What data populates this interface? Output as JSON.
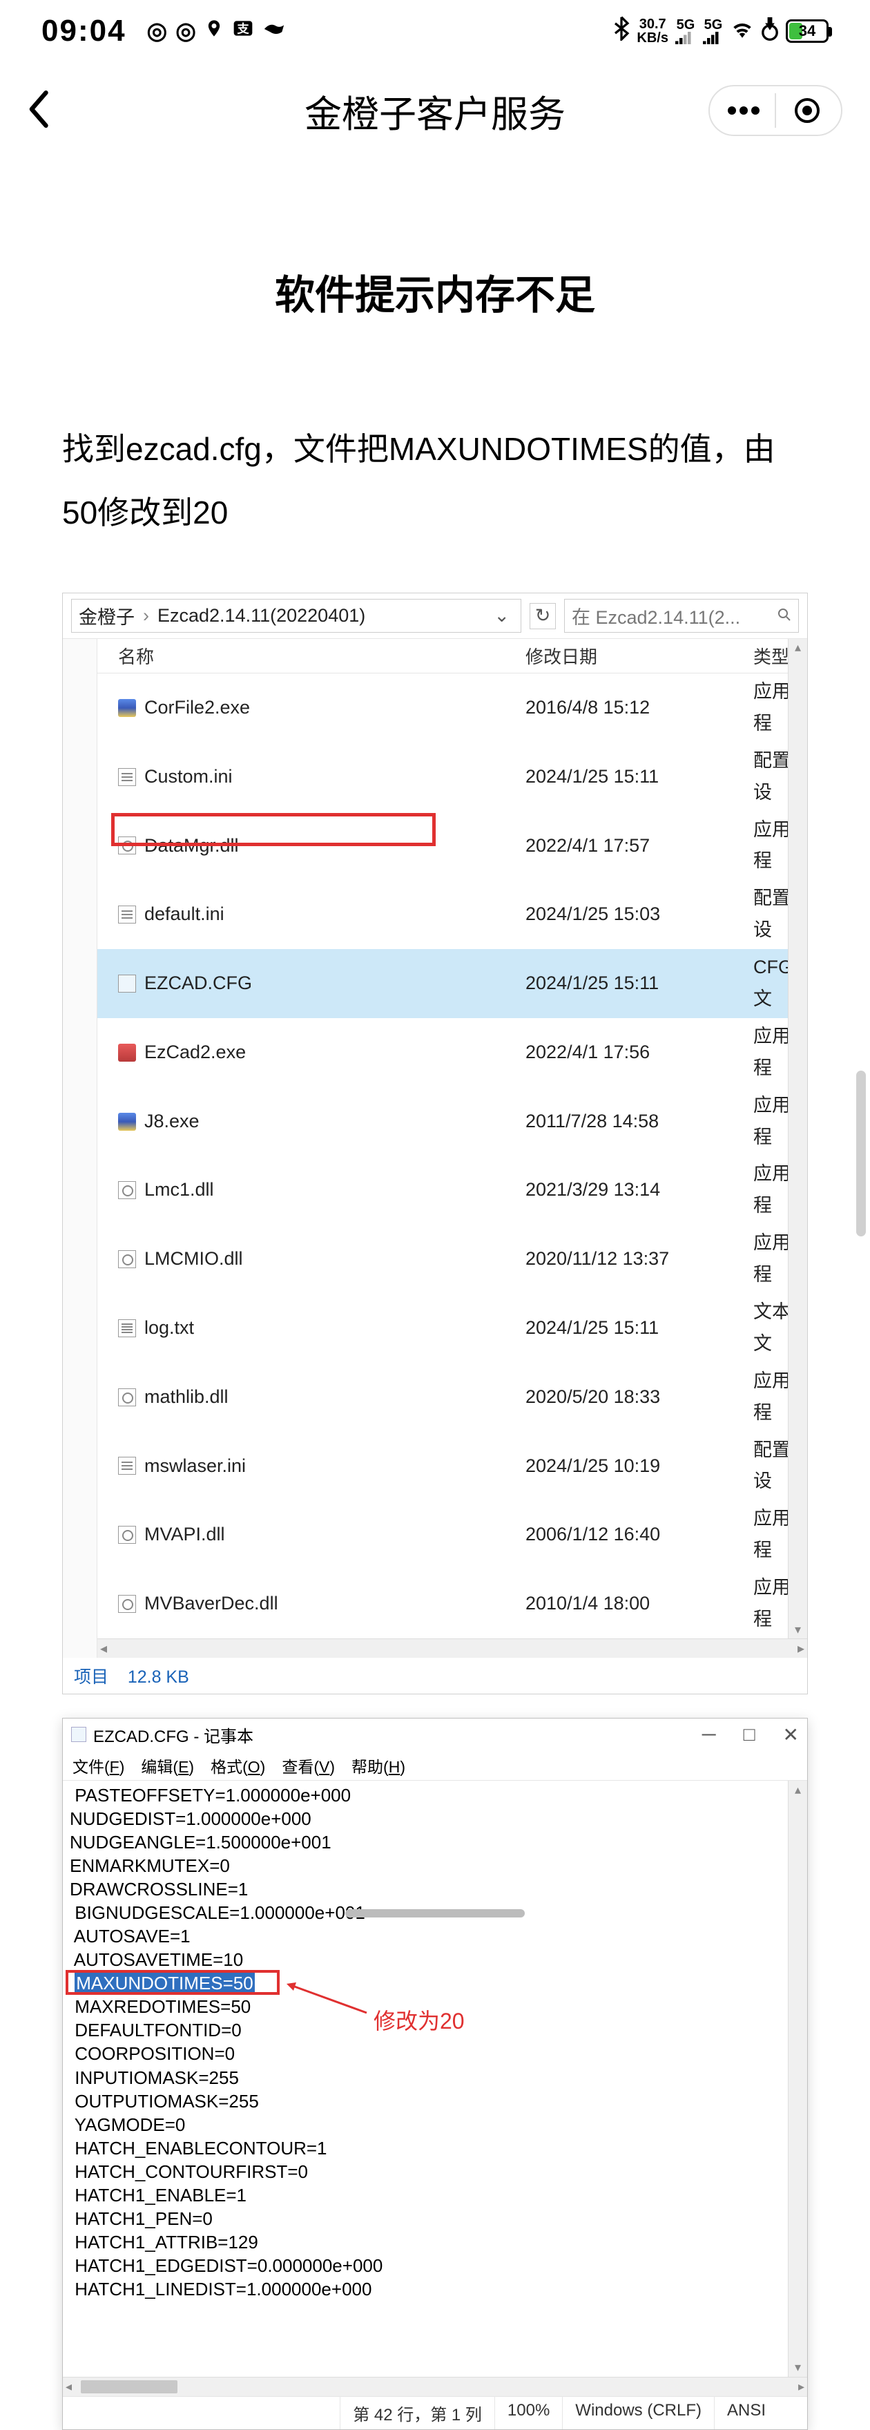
{
  "status": {
    "time": "09:04",
    "net_rate_top": "30.7",
    "net_rate_bot": "KB/s",
    "sig1": "5G",
    "sig2": "5G",
    "battery_pct": "34"
  },
  "header": {
    "title": "金橙子客户服务"
  },
  "article": {
    "title": "软件提示内存不足",
    "instruction": "找到ezcad.cfg，文件把MAXUNDOTIMES的值，由50修改到20"
  },
  "explorer": {
    "crumb1": "金橙子",
    "crumb2": "Ezcad2.14.11(20220401)",
    "search_placeholder": "在 Ezcad2.14.11(2...",
    "col_name": "名称",
    "col_date": "修改日期",
    "col_type": "类型",
    "files": [
      {
        "icon": "exe3",
        "name": "CorFile2.exe",
        "date": "2016/4/8 15:12",
        "type": "应用程"
      },
      {
        "icon": "ini",
        "name": "Custom.ini",
        "date": "2024/1/25 15:11",
        "type": "配置设"
      },
      {
        "icon": "dll",
        "name": "DataMgr.dll",
        "date": "2022/4/1 17:57",
        "type": "应用程"
      },
      {
        "icon": "ini",
        "name": "default.ini",
        "date": "2024/1/25 15:03",
        "type": "配置设"
      },
      {
        "icon": "cfg",
        "name": "EZCAD.CFG",
        "date": "2024/1/25 15:11",
        "type": "CFG 文",
        "sel": true
      },
      {
        "icon": "exe2",
        "name": "EzCad2.exe",
        "date": "2022/4/1 17:56",
        "type": "应用程"
      },
      {
        "icon": "exe3",
        "name": "J8.exe",
        "date": "2011/7/28 14:58",
        "type": "应用程"
      },
      {
        "icon": "dll",
        "name": "Lmc1.dll",
        "date": "2021/3/29 13:14",
        "type": "应用程"
      },
      {
        "icon": "dll",
        "name": "LMCMIO.dll",
        "date": "2020/11/12 13:37",
        "type": "应用程"
      },
      {
        "icon": "txt",
        "name": "log.txt",
        "date": "2024/1/25 15:11",
        "type": "文本文"
      },
      {
        "icon": "dll",
        "name": "mathlib.dll",
        "date": "2020/5/20 18:33",
        "type": "应用程"
      },
      {
        "icon": "ini",
        "name": "mswlaser.ini",
        "date": "2024/1/25 10:19",
        "type": "配置设"
      },
      {
        "icon": "dll",
        "name": "MVAPI.dll",
        "date": "2006/1/12 16:40",
        "type": "应用程"
      },
      {
        "icon": "dll",
        "name": "MVBaverDec.dll",
        "date": "2010/1/4 18:00",
        "type": "应用程"
      }
    ],
    "footer_label": "项目",
    "footer_size": "12.8 KB"
  },
  "notepad": {
    "title": "EZCAD.CFG - 记事本",
    "menu": {
      "file": "文件(F)",
      "edit": "编辑(E)",
      "format": "格式(O)",
      "view": "查看(V)",
      "help": "帮助(H)"
    },
    "lines_before": [
      " PASTEOFFSETY=1.000000e+000",
      "NUDGEDIST=1.000000e+000",
      "NUDGEANGLE=1.500000e+001",
      "ENMARKMUTEX=0",
      "DRAWCROSSLINE=1",
      " BIGNUDGESCALE=1.000000e+001",
      " AUTOSAVE=1",
      " AUTOSAVETIME=10"
    ],
    "highlight_line": "MAXUNDOTIMES=50",
    "lines_after": [
      " MAXREDOTIMES=50",
      " DEFAULTFONTID=0",
      " COORPOSITION=0",
      " INPUTIOMASK=255",
      " OUTPUTIOMASK=255",
      " YAGMODE=0",
      " HATCH_ENABLECONTOUR=1",
      " HATCH_CONTOURFIRST=0",
      " HATCH1_ENABLE=1",
      " HATCH1_PEN=0",
      " HATCH1_ATTRIB=129",
      " HATCH1_EDGEDIST=0.000000e+000",
      " HATCH1_LINEDIST=1.000000e+000"
    ],
    "annotation": "修改为20",
    "status": {
      "pos": "第 42 行，第 1 列",
      "zoom": "100%",
      "eol": "Windows (CRLF)",
      "enc": "ANSI"
    }
  }
}
